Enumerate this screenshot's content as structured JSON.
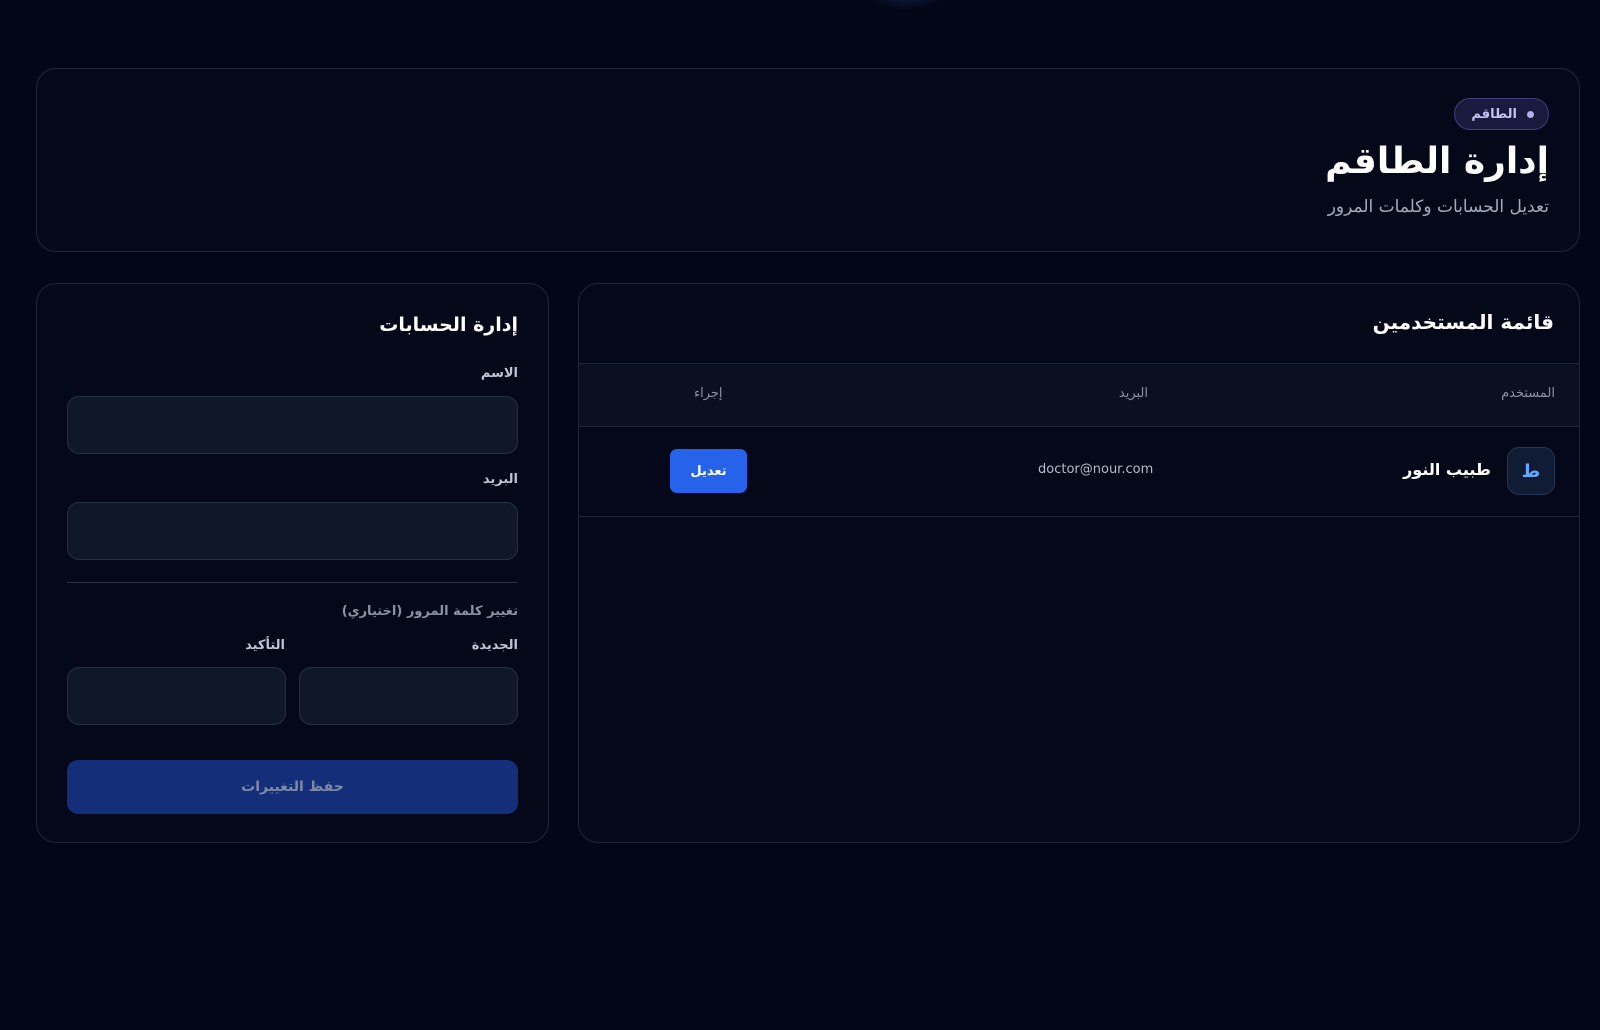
{
  "header": {
    "badge": "الطاقم",
    "title": "إدارة الطاقم",
    "subtitle": "تعديل الحسابات وكلمات المرور"
  },
  "users_list": {
    "title": "قائمة المستخدمين",
    "columns": {
      "user": "المستخدم",
      "email": "البريد",
      "action": "إجراء"
    },
    "rows": [
      {
        "avatar_initial": "ط",
        "name": "طبيب النور",
        "email": "doctor@nour.com",
        "action_label": "تعديل"
      }
    ]
  },
  "account_form": {
    "title": "إدارة الحسابات",
    "name_label": "الاسم",
    "name_value": "",
    "email_label": "البريد",
    "email_value": "",
    "password_section_label": "تغيير كلمة المرور (اختياري)",
    "new_password_label": "الجديدة",
    "confirm_password_label": "التأكيد",
    "save_label": "حفظ التغييرات"
  },
  "colors": {
    "background": "#030616",
    "accent": "#2663ea",
    "save_button_disabled": "#142e79",
    "badge": "#1a1a3e"
  },
  "icons": {
    "badge_dot": "dot-icon"
  }
}
